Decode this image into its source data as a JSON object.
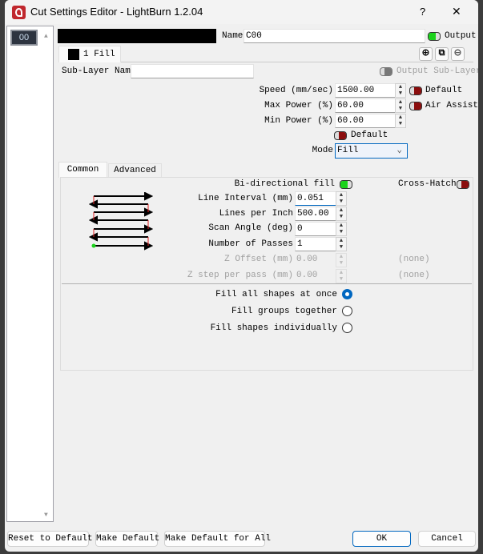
{
  "window": {
    "title": "Cut Settings Editor - LightBurn 1.2.04",
    "help_label": "?",
    "close_label": "✕"
  },
  "layer_list": {
    "items": [
      {
        "label": "00"
      }
    ]
  },
  "layer": {
    "color": "#000000",
    "name_label": "Name",
    "name_value": "C00",
    "output_label": "Output",
    "output_on": true,
    "sublayer_tab": "1 Fill",
    "sublayer_name_label": "Sub-Layer Name",
    "sublayer_name_value": "",
    "output_sublayer_label": "Output Sub-Layer"
  },
  "params": {
    "speed_label": "Speed (mm/sec)",
    "speed_value": "1500.00",
    "max_power_label": "Max Power (%)",
    "max_power_value": "60.00",
    "min_power_label": "Min Power (%)",
    "min_power_value": "60.00",
    "default_label": "Default",
    "default_on": false,
    "air_assist_label": "Air Assist",
    "air_assist_on": false,
    "default2_label": "Default",
    "default2_on": false,
    "mode_label": "Mode",
    "mode_value": "Fill"
  },
  "tabs": [
    {
      "label": "Common",
      "active": true
    },
    {
      "label": "Advanced",
      "active": false
    }
  ],
  "common": {
    "bidir_label": "Bi-directional fill",
    "bidir_on": true,
    "crosshatch_label": "Cross-Hatch",
    "crosshatch_on": false,
    "line_interval_label": "Line Interval (mm)",
    "line_interval_value": "0.051",
    "lpi_label": "Lines per Inch",
    "lpi_value": "500.00",
    "scan_angle_label": "Scan Angle (deg)",
    "scan_angle_value": "0",
    "passes_label": "Number of Passes",
    "passes_value": "1",
    "z_offset_label": "Z Offset (mm)",
    "z_offset_value": "0.00",
    "z_offset_none": "(none)",
    "z_step_label": "Z step per pass (mm)",
    "z_step_value": "0.00",
    "z_step_none": "(none)",
    "fill_options": [
      {
        "label": "Fill all shapes at once",
        "selected": true
      },
      {
        "label": "Fill groups together",
        "selected": false
      },
      {
        "label": "Fill shapes individually",
        "selected": false
      }
    ]
  },
  "buttons": {
    "reset": "Reset to Default",
    "make_default": "Make Default",
    "make_default_all": "Make Default for All",
    "ok": "OK",
    "cancel": "Cancel"
  }
}
